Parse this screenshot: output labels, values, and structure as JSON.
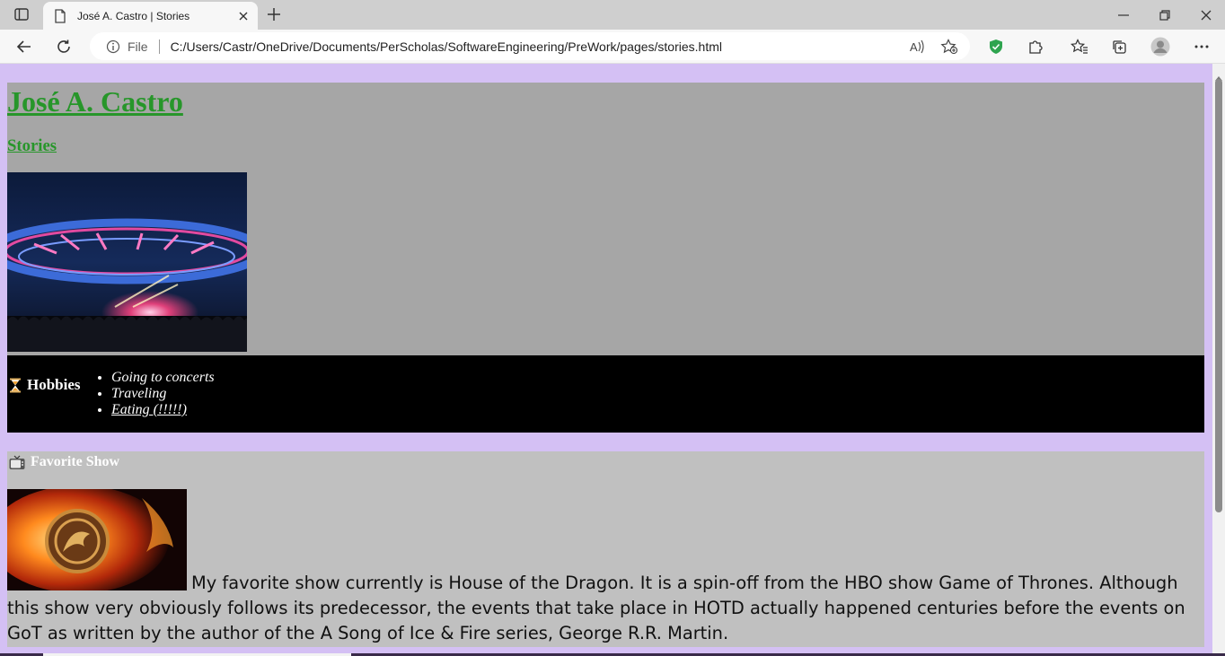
{
  "browser": {
    "tab": {
      "title": "José A. Castro | Stories"
    },
    "address": {
      "scheme_label": "File",
      "url": "C:/Users/Castr/OneDrive/Documents/PerScholas/SoftwareEngineering/PreWork/pages/stories.html"
    },
    "icons": {
      "tab_actions": "tab-actions-icon",
      "favicon": "page-icon",
      "close_tab": "close-icon",
      "new_tab": "plus-icon",
      "back": "arrow-left-icon",
      "refresh": "refresh-icon",
      "info": "info-icon",
      "read_aloud": "read-aloud-icon",
      "add_favorite": "star-plus-icon",
      "extension_shield": "shield-check-icon",
      "extensions": "puzzle-icon",
      "favorites": "favorites-icon",
      "collections": "collections-icon",
      "profile": "avatar-icon",
      "more": "ellipsis-icon",
      "minimize": "minimize-icon",
      "restore": "restore-icon",
      "close_window": "close-icon"
    }
  },
  "page": {
    "name": "José A. Castro",
    "section": "Stories",
    "hobbies": {
      "heading": "Hobbies",
      "icon": "hourglass-icon",
      "items": [
        "Going to concerts",
        "Traveling",
        "Eating (!!!!!)"
      ]
    },
    "show": {
      "heading": "Favorite Show",
      "icon": "tv-icon",
      "text": "My favorite show currently is House of the Dragon. It is a spin-off from the HBO show Game of Thrones. Although this show very obviously follows its predecessor, the events that take place in HOTD actually happened centuries before the events on GoT as written by the author of the A Song of Ice & Fire series, George R.R. Martin."
    },
    "colors": {
      "page_bg": "#d4c0f4",
      "header_bg": "#a6a6a6",
      "link": "#27962a",
      "hobbies_bg": "#000000",
      "show_bg": "#c0c0c0"
    }
  }
}
